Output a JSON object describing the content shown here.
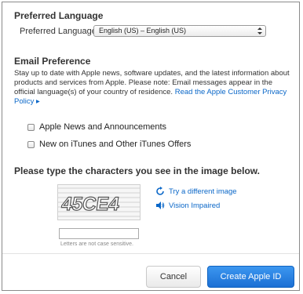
{
  "preferred_language": {
    "heading": "Preferred Language",
    "label": "Preferred Language",
    "selected": "English (US) – English (US)"
  },
  "email_preference": {
    "heading": "Email Preference",
    "paragraph": "Stay up to date with Apple news, software updates, and the latest information about products and services from Apple. Please note: Email messages appear in the official language(s) of your country of residence.",
    "policy_link": "Read the Apple Customer Privacy Policy",
    "checkboxes": [
      {
        "label": "Apple News and Announcements",
        "checked": false
      },
      {
        "label": "New on iTunes and Other iTunes Offers",
        "checked": false
      }
    ]
  },
  "captcha": {
    "instruction": "Please type the characters you see in the image below.",
    "image_text": "45CE4",
    "input_value": "",
    "hint": "Letters are not case sensitive.",
    "try_different": "Try a different image",
    "vision_impaired": "Vision Impaired"
  },
  "buttons": {
    "cancel": "Cancel",
    "create": "Create Apple ID"
  },
  "colors": {
    "link": "#0a67c8",
    "primary": "#1b6fd4"
  }
}
